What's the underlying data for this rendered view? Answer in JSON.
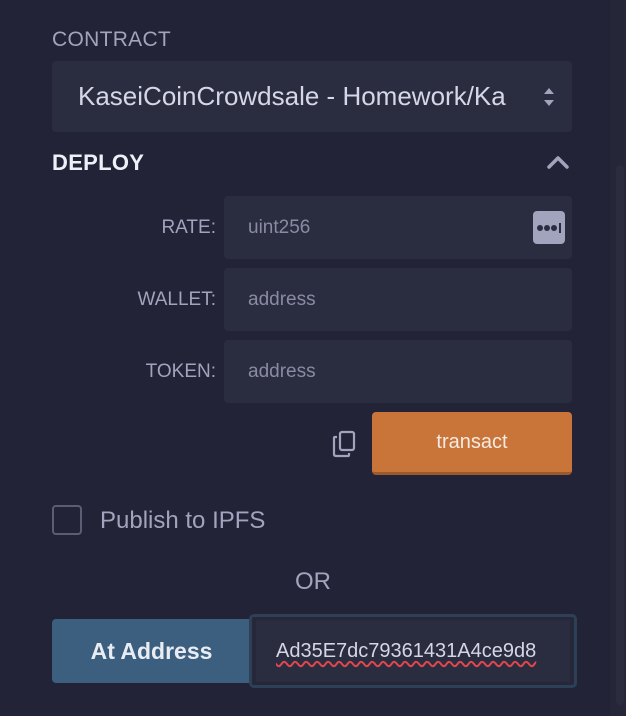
{
  "contract": {
    "section_label": "CONTRACT",
    "selected": "KaseiCoinCrowdsale - Homework/Ka"
  },
  "deploy": {
    "header": "DEPLOY",
    "params": [
      {
        "label": "RATE:",
        "placeholder": "uint256"
      },
      {
        "label": "WALLET:",
        "placeholder": "address"
      },
      {
        "label": "TOKEN:",
        "placeholder": "address"
      }
    ],
    "transact_label": "transact",
    "publish_label": "Publish to IPFS",
    "publish_checked": false
  },
  "or_label": "OR",
  "at_address": {
    "button_label": "At Address",
    "value": "Ad35E7dc79361431A4ce9d8"
  },
  "colors": {
    "background": "#222336",
    "input_bg": "#2a2c3f",
    "transact": "#c97539",
    "at_address": "#3c5f80"
  },
  "icons": [
    "select-arrows-icon",
    "chevron-up-icon",
    "more-icon",
    "copy-icon"
  ]
}
